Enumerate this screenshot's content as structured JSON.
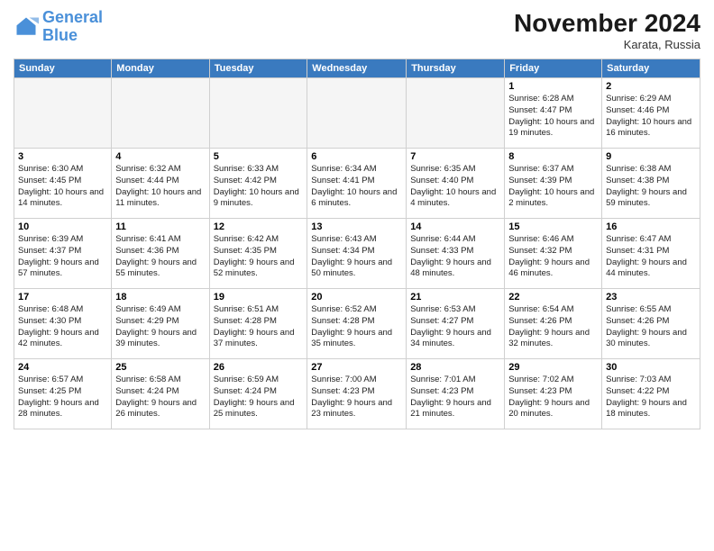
{
  "logo": {
    "text_general": "General",
    "text_blue": "Blue"
  },
  "header": {
    "month": "November 2024",
    "location": "Karata, Russia"
  },
  "weekdays": [
    "Sunday",
    "Monday",
    "Tuesday",
    "Wednesday",
    "Thursday",
    "Friday",
    "Saturday"
  ],
  "weeks": [
    [
      {
        "day": "",
        "info": ""
      },
      {
        "day": "",
        "info": ""
      },
      {
        "day": "",
        "info": ""
      },
      {
        "day": "",
        "info": ""
      },
      {
        "day": "",
        "info": ""
      },
      {
        "day": "1",
        "info": "Sunrise: 6:28 AM\nSunset: 4:47 PM\nDaylight: 10 hours and 19 minutes."
      },
      {
        "day": "2",
        "info": "Sunrise: 6:29 AM\nSunset: 4:46 PM\nDaylight: 10 hours and 16 minutes."
      }
    ],
    [
      {
        "day": "3",
        "info": "Sunrise: 6:30 AM\nSunset: 4:45 PM\nDaylight: 10 hours and 14 minutes."
      },
      {
        "day": "4",
        "info": "Sunrise: 6:32 AM\nSunset: 4:44 PM\nDaylight: 10 hours and 11 minutes."
      },
      {
        "day": "5",
        "info": "Sunrise: 6:33 AM\nSunset: 4:42 PM\nDaylight: 10 hours and 9 minutes."
      },
      {
        "day": "6",
        "info": "Sunrise: 6:34 AM\nSunset: 4:41 PM\nDaylight: 10 hours and 6 minutes."
      },
      {
        "day": "7",
        "info": "Sunrise: 6:35 AM\nSunset: 4:40 PM\nDaylight: 10 hours and 4 minutes."
      },
      {
        "day": "8",
        "info": "Sunrise: 6:37 AM\nSunset: 4:39 PM\nDaylight: 10 hours and 2 minutes."
      },
      {
        "day": "9",
        "info": "Sunrise: 6:38 AM\nSunset: 4:38 PM\nDaylight: 9 hours and 59 minutes."
      }
    ],
    [
      {
        "day": "10",
        "info": "Sunrise: 6:39 AM\nSunset: 4:37 PM\nDaylight: 9 hours and 57 minutes."
      },
      {
        "day": "11",
        "info": "Sunrise: 6:41 AM\nSunset: 4:36 PM\nDaylight: 9 hours and 55 minutes."
      },
      {
        "day": "12",
        "info": "Sunrise: 6:42 AM\nSunset: 4:35 PM\nDaylight: 9 hours and 52 minutes."
      },
      {
        "day": "13",
        "info": "Sunrise: 6:43 AM\nSunset: 4:34 PM\nDaylight: 9 hours and 50 minutes."
      },
      {
        "day": "14",
        "info": "Sunrise: 6:44 AM\nSunset: 4:33 PM\nDaylight: 9 hours and 48 minutes."
      },
      {
        "day": "15",
        "info": "Sunrise: 6:46 AM\nSunset: 4:32 PM\nDaylight: 9 hours and 46 minutes."
      },
      {
        "day": "16",
        "info": "Sunrise: 6:47 AM\nSunset: 4:31 PM\nDaylight: 9 hours and 44 minutes."
      }
    ],
    [
      {
        "day": "17",
        "info": "Sunrise: 6:48 AM\nSunset: 4:30 PM\nDaylight: 9 hours and 42 minutes."
      },
      {
        "day": "18",
        "info": "Sunrise: 6:49 AM\nSunset: 4:29 PM\nDaylight: 9 hours and 39 minutes."
      },
      {
        "day": "19",
        "info": "Sunrise: 6:51 AM\nSunset: 4:28 PM\nDaylight: 9 hours and 37 minutes."
      },
      {
        "day": "20",
        "info": "Sunrise: 6:52 AM\nSunset: 4:28 PM\nDaylight: 9 hours and 35 minutes."
      },
      {
        "day": "21",
        "info": "Sunrise: 6:53 AM\nSunset: 4:27 PM\nDaylight: 9 hours and 34 minutes."
      },
      {
        "day": "22",
        "info": "Sunrise: 6:54 AM\nSunset: 4:26 PM\nDaylight: 9 hours and 32 minutes."
      },
      {
        "day": "23",
        "info": "Sunrise: 6:55 AM\nSunset: 4:26 PM\nDaylight: 9 hours and 30 minutes."
      }
    ],
    [
      {
        "day": "24",
        "info": "Sunrise: 6:57 AM\nSunset: 4:25 PM\nDaylight: 9 hours and 28 minutes."
      },
      {
        "day": "25",
        "info": "Sunrise: 6:58 AM\nSunset: 4:24 PM\nDaylight: 9 hours and 26 minutes."
      },
      {
        "day": "26",
        "info": "Sunrise: 6:59 AM\nSunset: 4:24 PM\nDaylight: 9 hours and 25 minutes."
      },
      {
        "day": "27",
        "info": "Sunrise: 7:00 AM\nSunset: 4:23 PM\nDaylight: 9 hours and 23 minutes."
      },
      {
        "day": "28",
        "info": "Sunrise: 7:01 AM\nSunset: 4:23 PM\nDaylight: 9 hours and 21 minutes."
      },
      {
        "day": "29",
        "info": "Sunrise: 7:02 AM\nSunset: 4:23 PM\nDaylight: 9 hours and 20 minutes."
      },
      {
        "day": "30",
        "info": "Sunrise: 7:03 AM\nSunset: 4:22 PM\nDaylight: 9 hours and 18 minutes."
      }
    ]
  ]
}
